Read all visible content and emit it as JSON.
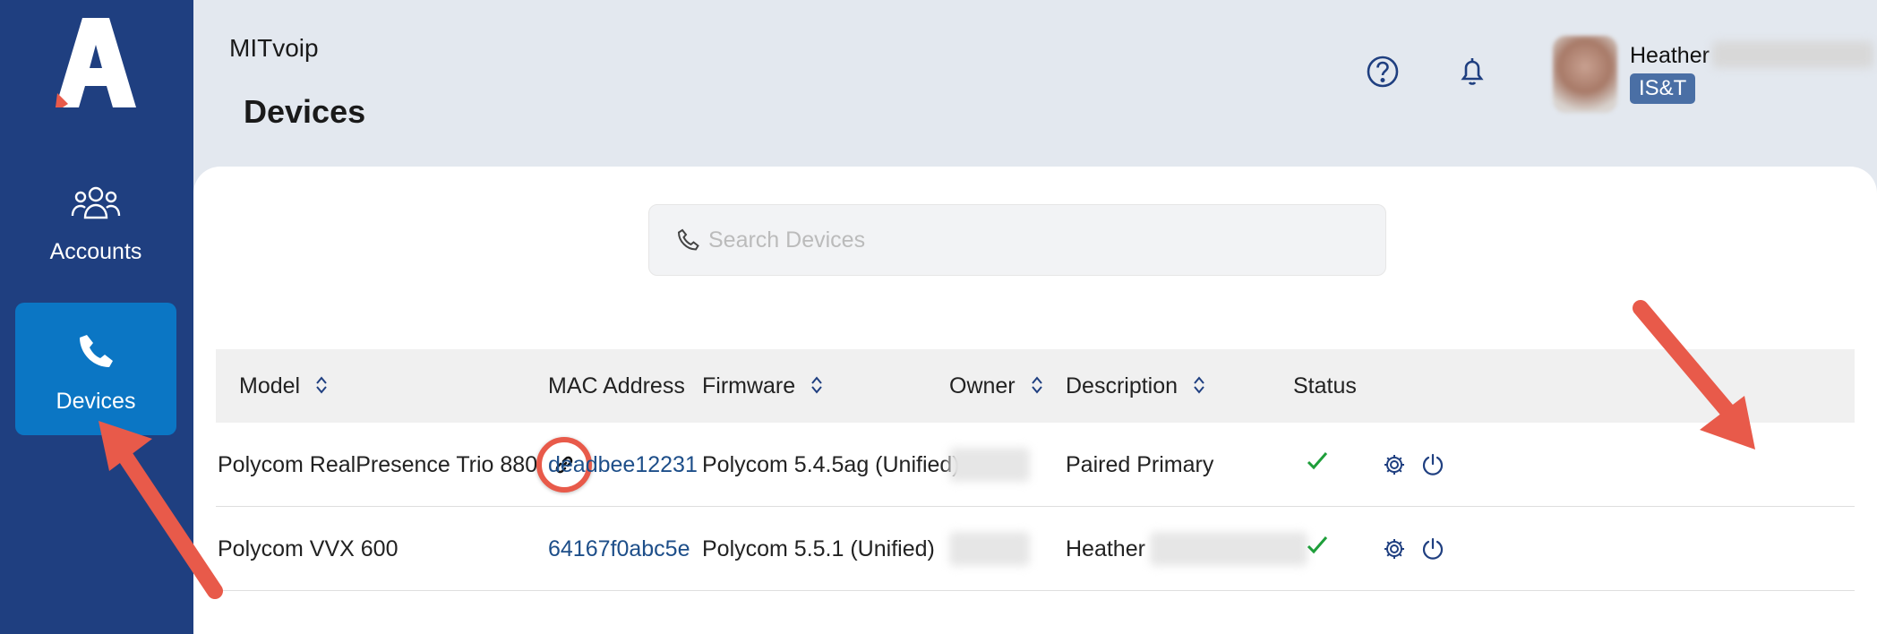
{
  "sidebar": {
    "items": [
      {
        "label": "Accounts",
        "icon": "users-icon",
        "active": false
      },
      {
        "label": "Devices",
        "icon": "phone-icon",
        "active": true
      }
    ]
  },
  "header": {
    "app_name": "MITvoip",
    "page_title": "Devices",
    "user_name": "Heather",
    "user_badge": "IS&T"
  },
  "search": {
    "placeholder": "Search Devices",
    "value": ""
  },
  "table": {
    "columns": [
      "Model",
      "MAC Address",
      "Firmware",
      "Owner",
      "Description",
      "Status"
    ],
    "rows": [
      {
        "model": "Polycom RealPresence Trio 8800",
        "mac": "deadbee12231",
        "firmware": "Polycom 5.4.5ag (Unified)",
        "description": "Paired Primary"
      },
      {
        "model": "Polycom VVX 600",
        "mac": "64167f0abc5e",
        "firmware": "Polycom 5.5.1 (Unified)",
        "description": "Heather"
      }
    ]
  },
  "colors": {
    "sidebar": "#1f3f80",
    "active_nav": "#0b76c4",
    "annotation": "#e85a4a",
    "status_ok": "#1e9e3a"
  }
}
